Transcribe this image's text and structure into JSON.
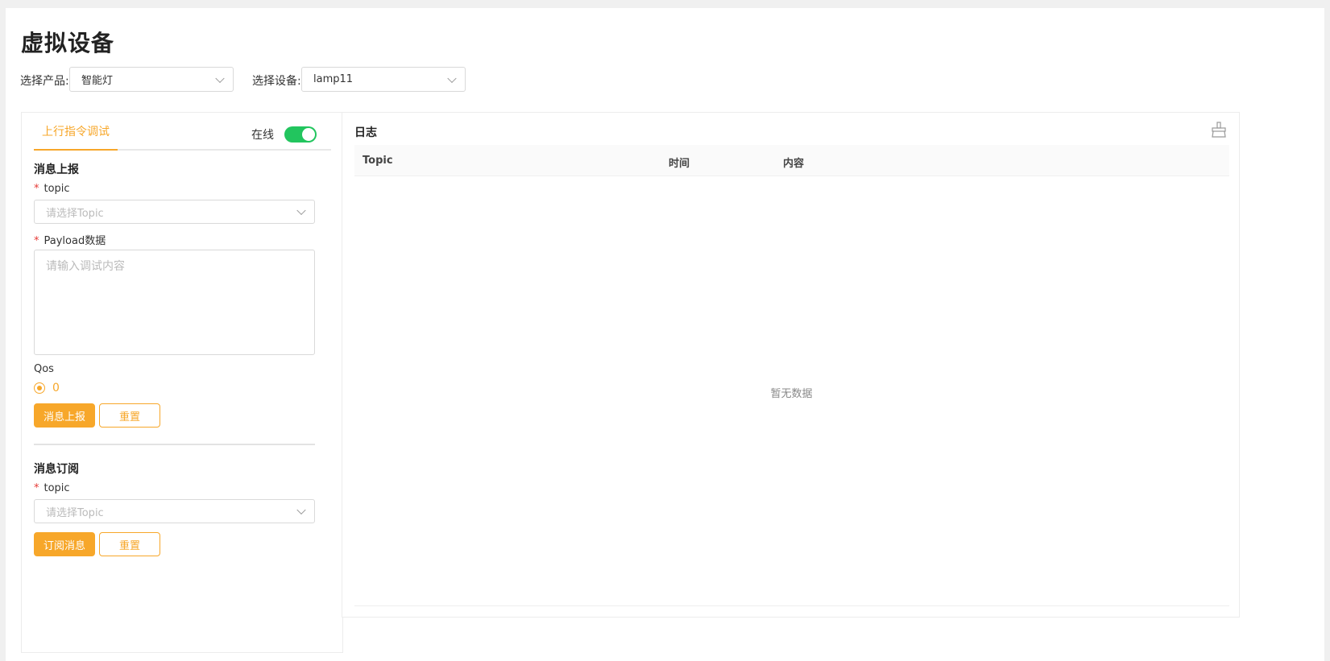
{
  "page": {
    "title": "虚拟设备"
  },
  "filters": {
    "product_label": "选择产品:",
    "product_value": "智能灯",
    "device_label": "选择设备:",
    "device_value": "lamp11"
  },
  "left": {
    "tab_label": "上行指令调试",
    "status_label": "在线",
    "status_on": true,
    "report": {
      "title": "消息上报",
      "topic_label": "topic",
      "topic_placeholder": "请选择Topic",
      "payload_label": "Payload数据",
      "payload_placeholder": "请输入调试内容",
      "qos_label": "Qos",
      "qos_value": "0",
      "submit_label": "消息上报",
      "reset_label": "重置"
    },
    "subscribe": {
      "title": "消息订阅",
      "topic_label": "topic",
      "topic_placeholder": "请选择Topic",
      "submit_label": "订阅消息",
      "reset_label": "重置"
    },
    "required_mark": "*"
  },
  "log": {
    "title": "日志",
    "columns": [
      "Topic",
      "时间",
      "内容"
    ],
    "empty_text": "暂无数据",
    "clear_icon": "broom-icon"
  },
  "colors": {
    "accent": "#f7a72a",
    "toggle_on": "#22c55e",
    "required": "#e53935"
  }
}
